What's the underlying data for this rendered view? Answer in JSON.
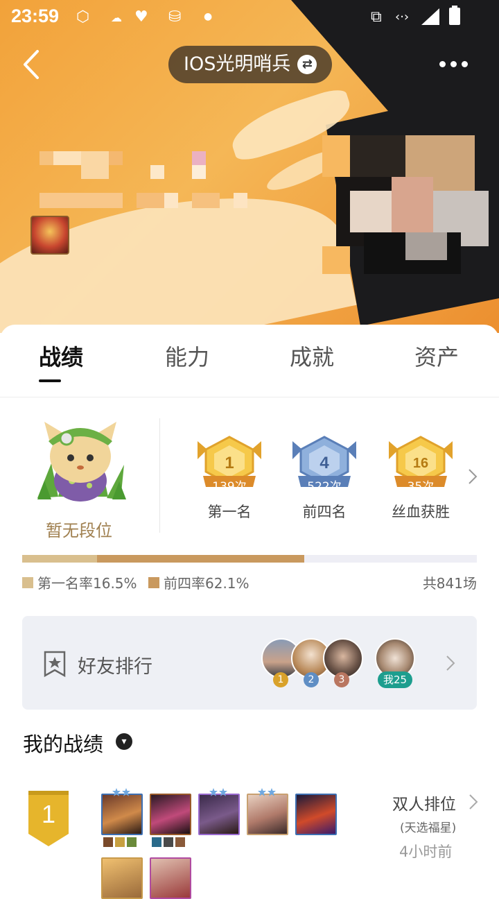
{
  "status_bar": {
    "time": "23:59",
    "icons": [
      "app-icon",
      "cloud-icon",
      "heartbeat-icon",
      "storage-icon",
      "dot-icon",
      "cast-icon",
      "data-icon",
      "signal-icon",
      "battery-icon"
    ]
  },
  "header": {
    "server_name": "IOS光明哨兵",
    "back_icon": "back-icon",
    "swap_icon": "swap-icon",
    "more_icon": "more-icon"
  },
  "tabs": [
    {
      "label": "战绩",
      "active": true
    },
    {
      "label": "能力",
      "active": false
    },
    {
      "label": "成就",
      "active": false
    },
    {
      "label": "资产",
      "active": false
    }
  ],
  "rank": {
    "label": "暂无段位"
  },
  "medals": [
    {
      "label": "第一名",
      "count": "139次",
      "number": "1",
      "color": "#f0b53a"
    },
    {
      "label": "前四名",
      "count": "522次",
      "number": "4",
      "color": "#6f93c6"
    },
    {
      "label": "丝血获胜",
      "count": "35次",
      "number": "16",
      "color": "#f0b53a"
    }
  ],
  "stats": {
    "first_rate_label": "第一名率16.5%",
    "top4_rate_label": "前四率62.1%",
    "total_label": "共841场",
    "first_rate": 0.165,
    "top4_rate": 0.621,
    "first_color": "#d9bf8e",
    "top4_color": "#c9995e"
  },
  "friends": {
    "label": "好友排行",
    "ranks": [
      {
        "rank": "1",
        "color": "#d9a22b"
      },
      {
        "rank": "2",
        "color": "#5f8ec4"
      },
      {
        "rank": "3",
        "color": "#b97660"
      }
    ],
    "me_label": "我25"
  },
  "records": {
    "title": "我的战绩",
    "matches": [
      {
        "placement": "1",
        "mode": "双人排位",
        "sub_mode": "(天选福星)",
        "time_ago": "4小时前"
      }
    ]
  }
}
